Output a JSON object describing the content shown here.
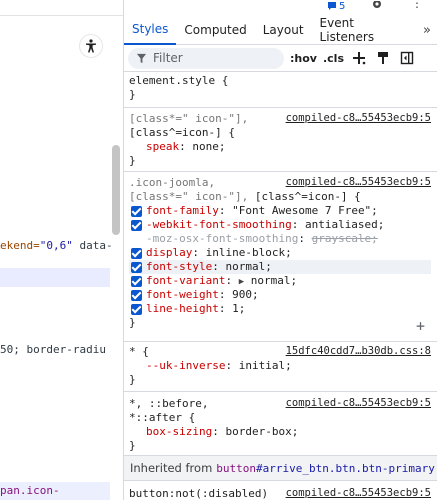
{
  "top_strip": {
    "badge_count": "5"
  },
  "left_pane": {
    "code1": [
      "ekend=",
      "\"0,6\"",
      " data-"
    ],
    "code2": "50; border-radiu",
    "selected_crumb": "pan.icon-calendar"
  },
  "tabs": [
    {
      "label": "Styles",
      "active": true
    },
    {
      "label": "Computed"
    },
    {
      "label": "Layout"
    },
    {
      "label": "Event Listeners"
    }
  ],
  "tab_more": "»",
  "filter": {
    "placeholder": "Filter",
    "hov": ":hov",
    "cls": ".cls"
  },
  "rules": {
    "element_style": {
      "selector": "element.style {",
      "close": "}"
    },
    "icon_any": {
      "selector1": "[class*=\" icon-\"],",
      "selector2": "[class^=icon-] {",
      "source": "compiled-c8…55453ecb9:5",
      "decls": [
        {
          "prop": "speak",
          "value": "none;"
        }
      ],
      "close": "}"
    },
    "icon_joomla": {
      "selector1": ".icon-joomla,",
      "selector2a": "[class*=\" icon-\"], ",
      "selector2b": "[class^=icon-] {",
      "source": "compiled-c8…55453ecb9:5",
      "decls": [
        {
          "prop": "font-family",
          "value": "\"Font Awesome 7 Free\";"
        },
        {
          "prop": "-webkit-font-smoothing",
          "value": "antialiased;"
        },
        {
          "prop": "-moz-osx-font-smoothing",
          "value": "grayscale;"
        },
        {
          "prop": "display",
          "value": "inline-block;"
        },
        {
          "prop": "font-style",
          "value": "normal;"
        },
        {
          "prop": "font-variant",
          "value": "normal;"
        },
        {
          "prop": "font-weight",
          "value": "900;"
        },
        {
          "prop": "line-height",
          "value": "1;"
        }
      ],
      "close": "}"
    },
    "star": {
      "selector": "* {",
      "source": "15dfc40cdd7…b30db.css:8",
      "decls": [
        {
          "prop": "--uk-inverse",
          "value": "initial;"
        }
      ],
      "close": "}"
    },
    "pseudo": {
      "selector1": "*, ::before,",
      "selector2": "*::after {",
      "source": "compiled-c8…55453ecb9:5",
      "decls": [
        {
          "prop": "box-sizing",
          "value": "border-box;"
        }
      ],
      "close": "}"
    },
    "inherited": {
      "label": "Inherited from",
      "element": "button",
      "id": "#arrive_btn.btn.btn-primary"
    },
    "button_rule": {
      "selector": "button:not(:disabled)",
      "source": "compiled-c8…55453ecb9:5"
    }
  }
}
